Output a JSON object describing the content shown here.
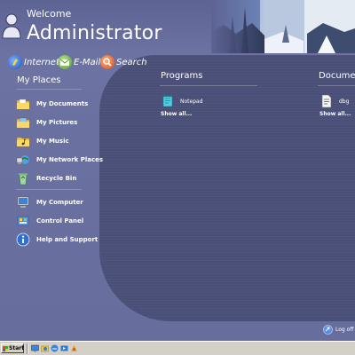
{
  "header": {
    "welcome": "Welcome",
    "user_name": "Administrator"
  },
  "quick_links": [
    {
      "label": "Internet",
      "icon": "internet-icon"
    },
    {
      "label": "E-Mail",
      "icon": "email-icon"
    },
    {
      "label": "Search",
      "icon": "search-icon"
    }
  ],
  "my_places": {
    "title": "My Places",
    "items": [
      {
        "label": "My Documents",
        "icon": "folder-documents-icon"
      },
      {
        "label": "My Pictures",
        "icon": "folder-pictures-icon"
      },
      {
        "label": "My Music",
        "icon": "folder-music-icon"
      },
      {
        "label": "My Network Places",
        "icon": "network-places-icon"
      },
      {
        "label": "Recycle Bin",
        "icon": "recycle-bin-icon"
      },
      {
        "label": "My Computer",
        "icon": "computer-icon"
      },
      {
        "label": "Control Panel",
        "icon": "control-panel-icon"
      },
      {
        "label": "Help and Support",
        "icon": "help-icon"
      }
    ]
  },
  "programs": {
    "title": "Programs",
    "items": [
      {
        "label": "Notepad",
        "icon": "notepad-icon"
      }
    ],
    "show_all": "Show all..."
  },
  "documents": {
    "title": "Documen",
    "items": [
      {
        "label": "dbg",
        "icon": "document-icon"
      }
    ],
    "show_all": "Show all..."
  },
  "log_off": {
    "label": "Log off",
    "icon": "log-off-icon"
  },
  "taskbar": {
    "start_label": "Start",
    "quick_launch": [
      "desktop-icon",
      "explorer-icon",
      "ie-icon",
      "media-icon",
      "outlook-icon"
    ]
  },
  "colors": {
    "background": "#4a4f78",
    "left_pane": "#6a70a0",
    "taskbar": "#d4d0c8"
  }
}
